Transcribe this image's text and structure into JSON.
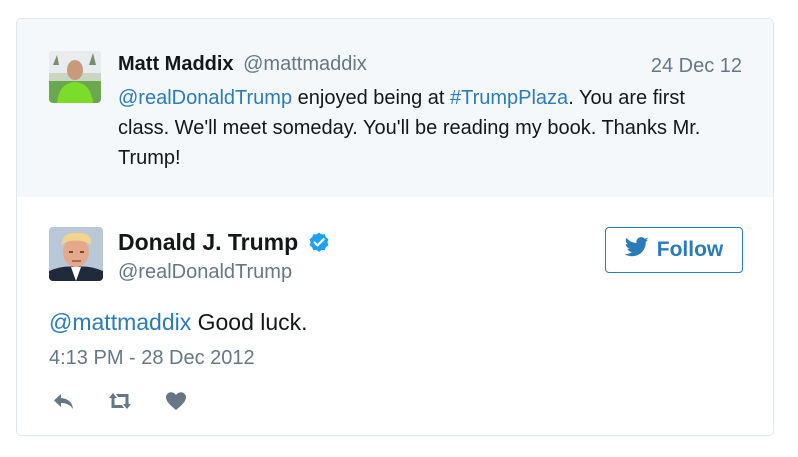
{
  "reply_context": {
    "author_name": "Matt Maddix",
    "author_handle": "@mattmaddix",
    "date": "24 Dec 12",
    "text_mention": "@realDonaldTrump",
    "text_part1": " enjoyed being at ",
    "text_hashtag": "#TrumpPlaza",
    "text_part2": ". You are first class. We'll meet someday. You'll be reading my book. Thanks Mr. Trump!"
  },
  "tweet": {
    "author_name": "Donald J. Trump",
    "author_handle": "@realDonaldTrump",
    "verified_icon": "verified-badge-icon",
    "follow_label": "Follow",
    "text_mention": "@mattmaddix",
    "text_body": " Good luck.",
    "timestamp": "4:13 PM - 28 Dec 2012"
  },
  "actions": {
    "icons": [
      "reply-icon",
      "retweet-icon",
      "like-heart-icon"
    ]
  },
  "colors": {
    "link": "#2b7bb9",
    "muted": "#657786",
    "reply_bg": "#f5f8fa",
    "border": "#e1e8ed",
    "verified": "#1da1f2"
  }
}
